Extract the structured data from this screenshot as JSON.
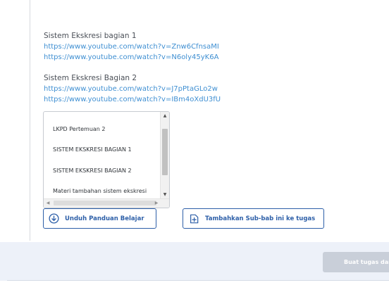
{
  "sections": [
    {
      "title": "Sistem Ekskresi bagian 1",
      "links": [
        "https://www.youtube.com/watch?v=Znw6CfnsaMI",
        "https://www.youtube.com/watch?v=N6oly45yK6A"
      ]
    },
    {
      "title": "Sistem Ekskresi Bagian 2",
      "links": [
        "https://www.youtube.com/watch?v=J7pPtaGLo2w",
        "https://www.youtube.com/watch?v=IBm4oXdU3fU"
      ]
    }
  ],
  "list": {
    "items": [
      "LKPD Pertemuan 2",
      "SISTEM EKSKRESI BAGIAN 1",
      "SISTEM EKSKRESI BAGIAN 2",
      "Materi tambahan sistem ekskresi"
    ]
  },
  "buttons": {
    "download_label": "Unduh Panduan Belajar",
    "add_task_label": "Tambahkan Sub-bab ini ke tugas"
  },
  "footer": {
    "primary_label": "Buat tugas dari"
  },
  "colors": {
    "link": "#3f8fd2",
    "accent": "#2d5fa8",
    "footer_bg": "#edf1f9",
    "disabled_button": "#c9cfd9"
  }
}
